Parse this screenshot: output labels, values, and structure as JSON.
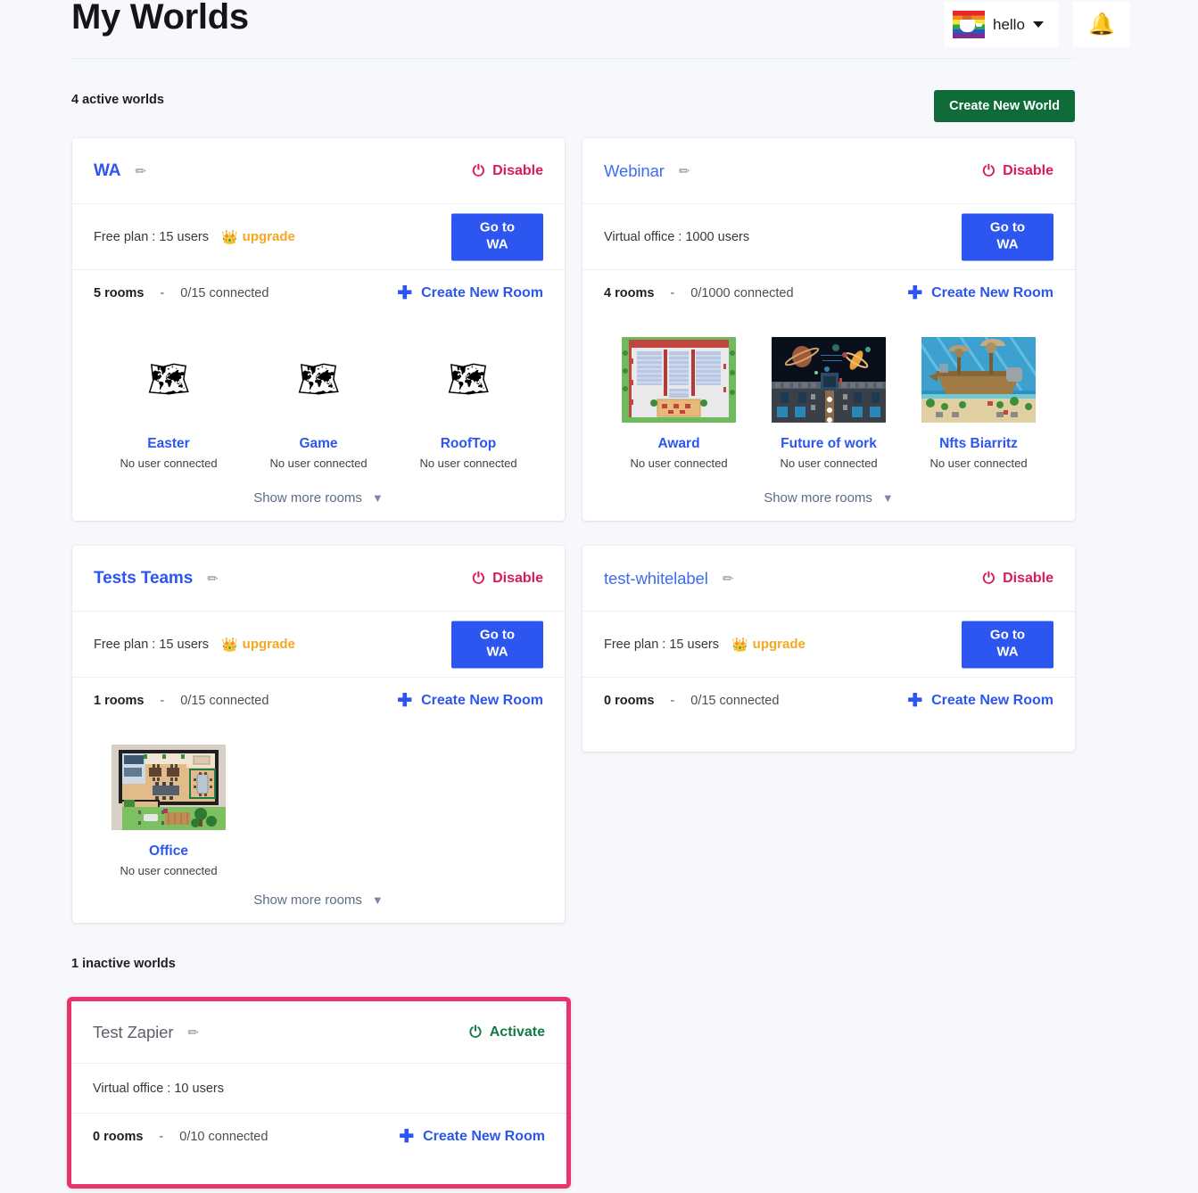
{
  "header": {
    "title": "My Worlds",
    "user_name": "hello",
    "avatar_icon": "pride-mug-avatar",
    "caret_icon": "chevron-down-icon",
    "bell_icon": "🔔"
  },
  "toolbar": {
    "active_label": "4 active worlds",
    "inactive_label": "1 inactive worlds",
    "create_world_label": "Create New World"
  },
  "labels": {
    "dash": "-",
    "pencil_icon": "✏",
    "power_icon": "⏻",
    "plus_icon": "✚",
    "chevron_icon": "❯",
    "crown_icon": "👑",
    "upgrade": "upgrade",
    "show_more": "Show more rooms",
    "create_room": "Create New Room",
    "goto_line1": "Go to",
    "goto_line2": "WA",
    "no_user": "No user connected",
    "map_icon": "🗺"
  },
  "colors": {
    "accent_blue": "#2c56ef",
    "disable_pink": "#d81b60",
    "activate_green": "#117a44",
    "create_world_green": "#0f6b37",
    "upgrade_orange": "#f5a623",
    "inactive_border": "#e8336d",
    "page_bg": "#f7f8fb"
  },
  "worlds": [
    {
      "name": "WA",
      "state_label": "Disable",
      "state": "active",
      "plan": "Free plan : 15 users",
      "has_upgrade": true,
      "rooms_count": "5 rooms",
      "connected": "0/15 connected",
      "has_show_more": true,
      "rooms": [
        {
          "name": "Easter",
          "status": "No user connected",
          "thumb": "map-icon"
        },
        {
          "name": "Game",
          "status": "No user connected",
          "thumb": "map-icon"
        },
        {
          "name": "RoofTop",
          "status": "No user connected",
          "thumb": "map-icon"
        }
      ]
    },
    {
      "name": "Webinar",
      "state_label": "Disable",
      "state": "active",
      "plan": "Virtual office : 1000 users",
      "has_upgrade": false,
      "rooms_count": "4 rooms",
      "connected": "0/1000 connected",
      "has_show_more": true,
      "rooms": [
        {
          "name": "Award",
          "status": "No user connected",
          "thumb": "auditorium-map"
        },
        {
          "name": "Future of work",
          "status": "No user connected",
          "thumb": "space-map"
        },
        {
          "name": "Nfts Biarritz",
          "status": "No user connected",
          "thumb": "ship-map"
        }
      ]
    },
    {
      "name": "Tests Teams",
      "state_label": "Disable",
      "state": "active",
      "plan": "Free plan : 15 users",
      "has_upgrade": true,
      "rooms_count": "1 rooms",
      "connected": "0/15 connected",
      "has_show_more": true,
      "rooms": [
        {
          "name": "Office",
          "status": "No user connected",
          "thumb": "office-map"
        }
      ]
    },
    {
      "name": "test-whitelabel",
      "state_label": "Disable",
      "state": "active",
      "plan": "Free plan : 15 users",
      "has_upgrade": true,
      "rooms_count": "0 rooms",
      "connected": "0/15 connected",
      "has_show_more": false,
      "rooms": []
    },
    {
      "name": "Test Zapier",
      "state_label": "Activate",
      "state": "inactive",
      "plan": "Virtual office : 10 users",
      "has_upgrade": false,
      "rooms_count": "0 rooms",
      "connected": "0/10 connected",
      "has_show_more": false,
      "rooms": []
    }
  ]
}
